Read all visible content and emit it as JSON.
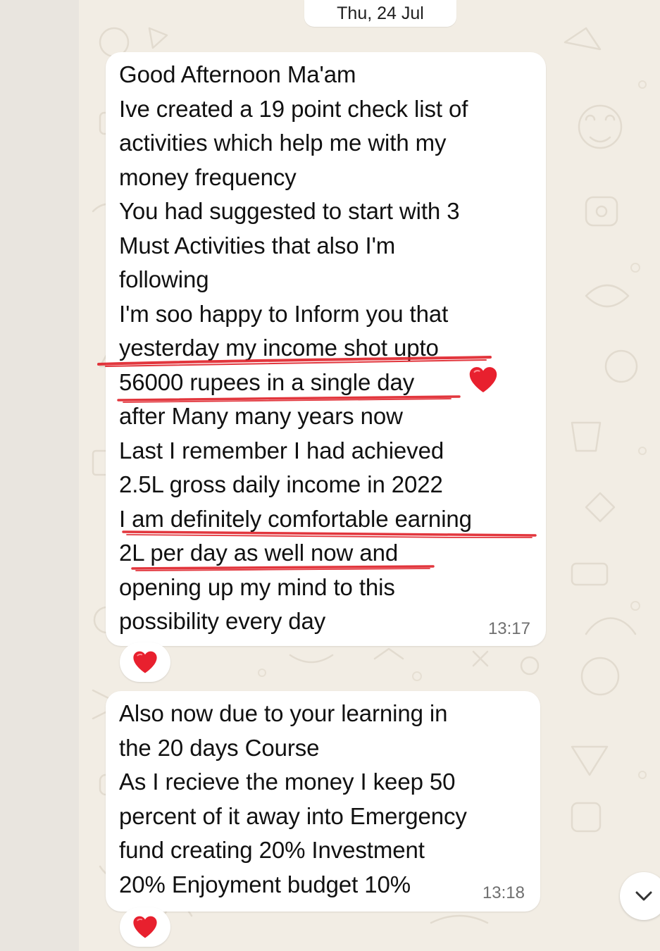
{
  "chat": {
    "date_label": "Thu, 24 Jul",
    "messages": [
      {
        "text": "Good Afternoon Ma'am\nIve created a 19 point check list of\nactivities which help me with my\nmoney frequency\nYou had suggested to start with 3\nMust Activities that also I'm\nfollowing\nI'm soo happy to Inform you that\nyesterday my income shot upto\n56000 rupees in a single day\nafter Many many years now\nLast I remember I had achieved\n2.5L gross daily income in 2022\nI am definitely comfortable earning\n2L per day as well now and\nopening up my mind to this\npossibility every day",
        "time": "13:17",
        "inline_emoji": "red-heart",
        "reaction": "red-heart"
      },
      {
        "text": "Also now due to your learning in\nthe 20 days Course\nAs I recieve the money I keep 50\npercent of it away into Emergency\nfund creating 20% Investment\n20% Enjoyment budget 10%",
        "time": "13:18",
        "reaction": "red-heart"
      }
    ],
    "scroll_button_icon": "chevron-down-icon",
    "colors": {
      "chat_background": "#f2ede4",
      "bubble": "#ffffff",
      "heart": "#e8202e",
      "marker_underline": "#e0252d",
      "timestamp": "#6f6f6f"
    }
  }
}
